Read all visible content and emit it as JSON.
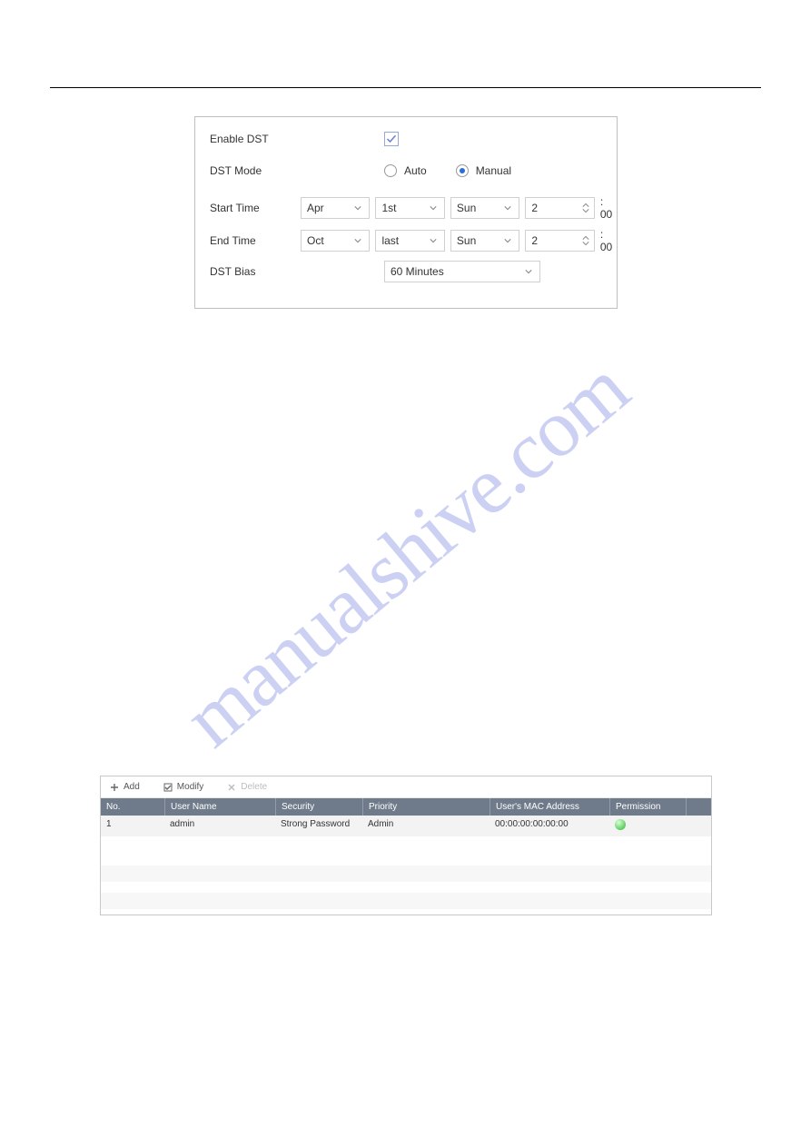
{
  "watermark": "manualshive.com",
  "dst": {
    "enable_label": "Enable DST",
    "enable_checked": true,
    "mode_label": "DST Mode",
    "mode_options": {
      "auto": "Auto",
      "manual": "Manual"
    },
    "mode_selected": "manual",
    "start_label": "Start Time",
    "end_label": "End Time",
    "bias_label": "DST Bias",
    "start": {
      "month": "Apr",
      "week": "1st",
      "day": "Sun",
      "hour": "2",
      "minute_suffix": ": 00"
    },
    "end": {
      "month": "Oct",
      "week": "last",
      "day": "Sun",
      "hour": "2",
      "minute_suffix": ": 00"
    },
    "bias_value": "60 Minutes"
  },
  "users": {
    "toolbar": {
      "add": "Add",
      "modify": "Modify",
      "delete": "Delete"
    },
    "columns": {
      "no": "No.",
      "user": "User Name",
      "security": "Security",
      "priority": "Priority",
      "mac": "User's MAC Address",
      "permission": "Permission"
    },
    "rows": [
      {
        "no": "1",
        "user": "admin",
        "security": "Strong Password",
        "priority": "Admin",
        "mac": "00:00:00:00:00:00",
        "permission_ok": true
      }
    ]
  }
}
